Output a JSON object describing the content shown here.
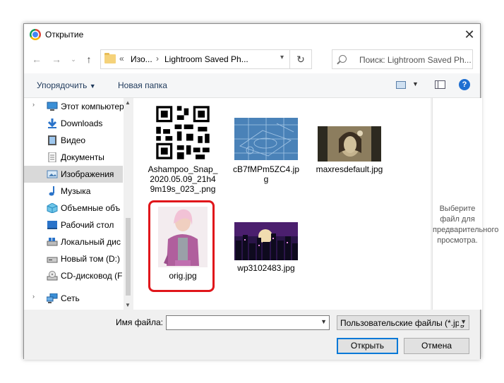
{
  "window": {
    "title": "Открытие"
  },
  "navigation": {
    "breadcrumb": [
      "Изо...",
      "Lightroom Saved Ph..."
    ],
    "search_placeholder": "Поиск: Lightroom Saved Ph..."
  },
  "toolbar": {
    "organize": "Упорядочить",
    "new_folder": "Новая папка"
  },
  "sidebar": {
    "items": [
      {
        "label": "Этот компьютер",
        "icon": "computer-icon"
      },
      {
        "label": "Downloads",
        "icon": "downloads-icon"
      },
      {
        "label": "Видео",
        "icon": "video-icon"
      },
      {
        "label": "Документы",
        "icon": "documents-icon"
      },
      {
        "label": "Изображения",
        "icon": "pictures-icon",
        "selected": true
      },
      {
        "label": "Музыка",
        "icon": "music-icon"
      },
      {
        "label": "Объемные объ",
        "icon": "3d-objects-icon"
      },
      {
        "label": "Рабочий стол",
        "icon": "desktop-icon"
      },
      {
        "label": "Локальный дис",
        "icon": "drive-icon"
      },
      {
        "label": "Новый том (D:)",
        "icon": "drive-icon"
      },
      {
        "label": "CD-дисковод (F",
        "icon": "cd-drive-icon"
      },
      {
        "label": "Сеть",
        "icon": "network-icon"
      }
    ]
  },
  "files": [
    {
      "name": "Ashampoo_Snap_2020.05.09_21h49m19s_023_.png",
      "thumb": "qr-code"
    },
    {
      "name": "cB7fMPm5ZC4.jpg",
      "thumb": "blueprint"
    },
    {
      "name": "maxresdefault.jpg",
      "thumb": "sepia-photo"
    },
    {
      "name": "orig.jpg",
      "thumb": "portrait",
      "highlighted": true
    },
    {
      "name": "wp3102483.jpg",
      "thumb": "city-night"
    }
  ],
  "preview": {
    "text": "Выберите файл для предварительного просмотра."
  },
  "bottom": {
    "filename_label": "Имя файла:",
    "filename_value": "",
    "filetype": "Пользовательские файлы (*.jpg",
    "open": "Открыть",
    "cancel": "Отмена"
  },
  "colors": {
    "highlight": "#e0161b",
    "accent": "#0078d7",
    "selected": "#d9d9d9"
  }
}
